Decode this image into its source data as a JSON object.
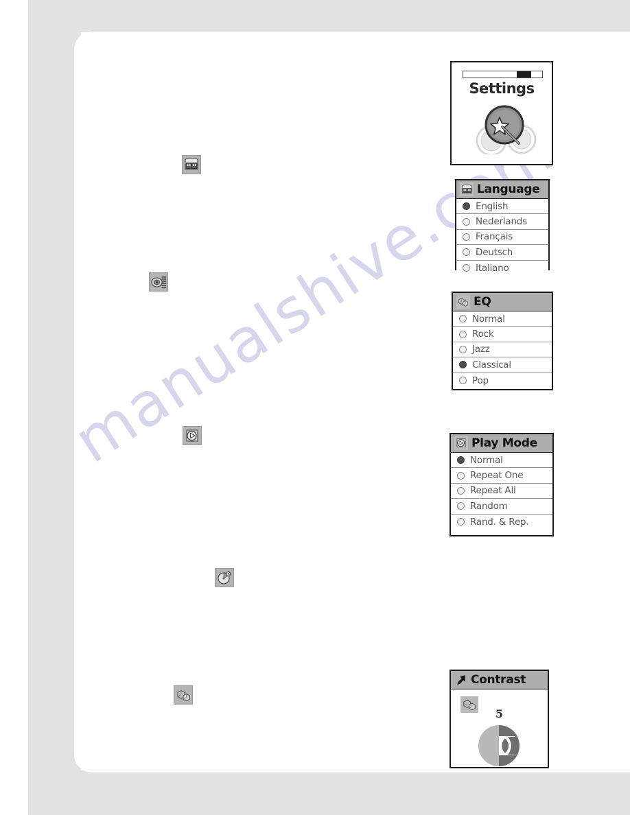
{
  "page": {
    "watermark": "manualshive.com"
  },
  "body_icons": [
    {
      "name": "language-icon",
      "alt": "language"
    },
    {
      "name": "equalizer-icon",
      "alt": "equalizer"
    },
    {
      "name": "play-mode-icon",
      "alt": "play mode"
    },
    {
      "name": "power-off-icon",
      "alt": "power off time"
    },
    {
      "name": "contrast-icon",
      "alt": "contrast"
    }
  ],
  "screens": {
    "settings": {
      "title": "Settings",
      "progress_percent": 68,
      "icon": "magic-wand-star-icon"
    },
    "language": {
      "title": "Language",
      "icon": "language-icon",
      "options": [
        {
          "label": "English",
          "selected": true
        },
        {
          "label": "Nederlands",
          "selected": false
        },
        {
          "label": "Français",
          "selected": false
        },
        {
          "label": "Deutsch",
          "selected": false
        },
        {
          "label": "Italiano",
          "selected": false
        }
      ]
    },
    "eq": {
      "title": "EQ",
      "icon": "equalizer-cubes-icon",
      "options": [
        {
          "label": "Normal",
          "selected": false
        },
        {
          "label": "Rock",
          "selected": false
        },
        {
          "label": "Jazz",
          "selected": false
        },
        {
          "label": "Classical",
          "selected": true
        },
        {
          "label": "Pop",
          "selected": false
        }
      ]
    },
    "play_mode": {
      "title": "Play Mode",
      "icon": "play-mode-icon",
      "options": [
        {
          "label": "Normal",
          "selected": true
        },
        {
          "label": "Repeat One",
          "selected": false
        },
        {
          "label": "Repeat All",
          "selected": false
        },
        {
          "label": "Random",
          "selected": false
        },
        {
          "label": "Rand. & Rep.",
          "selected": false
        }
      ]
    },
    "contrast": {
      "title": "Contrast",
      "icon": "arrow-pointer-icon",
      "body_icon": "contrast-cubes-icon",
      "value": "5"
    }
  }
}
